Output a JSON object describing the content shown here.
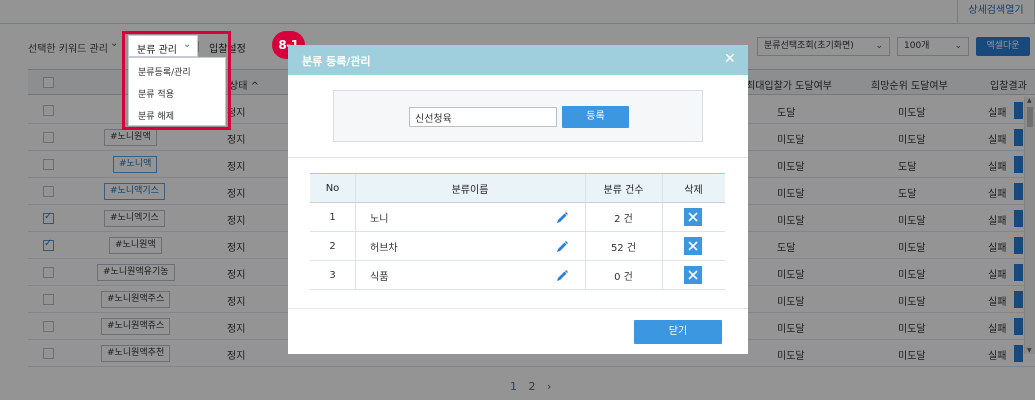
{
  "detail_tab": "상세검색열기",
  "toolbar": {
    "selected_keyword_manage": "선택한 키워드 관리",
    "category_manage": "분류 관리",
    "bid_label": "입찰설정",
    "view_select": "분류선택조회(초기화면)",
    "rows_select": "100개",
    "excel_button": "엑셀다운"
  },
  "grid": {
    "headers": {
      "status": "상태",
      "max_bid": "최대입찰가 도달여부",
      "rank": "희망순위 도달여부",
      "result": "입찰결과"
    },
    "rows": [
      {
        "keyword": "",
        "status": "정지",
        "max_bid": "도달",
        "rank": "미도달",
        "result": "실패",
        "checked": false,
        "blue": false
      },
      {
        "keyword": "#노니원액",
        "status": "정지",
        "max_bid": "미도달",
        "rank": "미도달",
        "result": "실패",
        "checked": false,
        "blue": false
      },
      {
        "keyword": "#노니액",
        "status": "정지",
        "max_bid": "미도달",
        "rank": "도달",
        "result": "실패",
        "checked": false,
        "blue": true
      },
      {
        "keyword": "#노니액기스",
        "status": "정지",
        "max_bid": "미도달",
        "rank": "도달",
        "result": "실패",
        "checked": false,
        "blue": true
      },
      {
        "keyword": "#노니엑기스",
        "status": "정지",
        "max_bid": "미도달",
        "rank": "미도달",
        "result": "실패",
        "checked": true,
        "blue": false
      },
      {
        "keyword": "#노니원액",
        "status": "정지",
        "max_bid": "도달",
        "rank": "미도달",
        "result": "실패",
        "checked": true,
        "blue": false
      },
      {
        "keyword": "#노니원액유기농",
        "status": "정지",
        "max_bid": "미도달",
        "rank": "미도달",
        "result": "실패",
        "checked": false,
        "blue": false
      },
      {
        "keyword": "#노니원액주스",
        "status": "정지",
        "max_bid": "미도달",
        "rank": "미도달",
        "result": "실패",
        "checked": false,
        "blue": false
      },
      {
        "keyword": "#노니원액쥬스",
        "status": "정지",
        "max_bid": "미도달",
        "rank": "미도달",
        "result": "실패",
        "checked": false,
        "blue": false
      },
      {
        "keyword": "#노니원액추천",
        "status": "정지",
        "max_bid": "미도달",
        "rank": "미도달",
        "result": "실패",
        "checked": false,
        "blue": false
      }
    ]
  },
  "pagination": {
    "pages": [
      "1",
      "2"
    ],
    "next": "›"
  },
  "dropdown": {
    "items": [
      "분류등록/관리",
      "분류 적용",
      "분류 해제"
    ]
  },
  "step_badge": "8-1",
  "modal": {
    "title": "분류 등록/관리",
    "input_value": "신선청육",
    "register_button": "등록",
    "table_headers": {
      "no": "No",
      "name": "분류이름",
      "count": "분류 건수",
      "delete": "삭제"
    },
    "rows": [
      {
        "no": "1",
        "name": "노니",
        "count": "2 건"
      },
      {
        "no": "2",
        "name": "허브차",
        "count": "52 건"
      },
      {
        "no": "3",
        "name": "식품",
        "count": "0 건"
      }
    ],
    "close_button": "닫기"
  },
  "colors": {
    "accent_blue": "#3d97e0",
    "modal_header": "#9fcfdc",
    "highlight_red": "#d7003a"
  }
}
